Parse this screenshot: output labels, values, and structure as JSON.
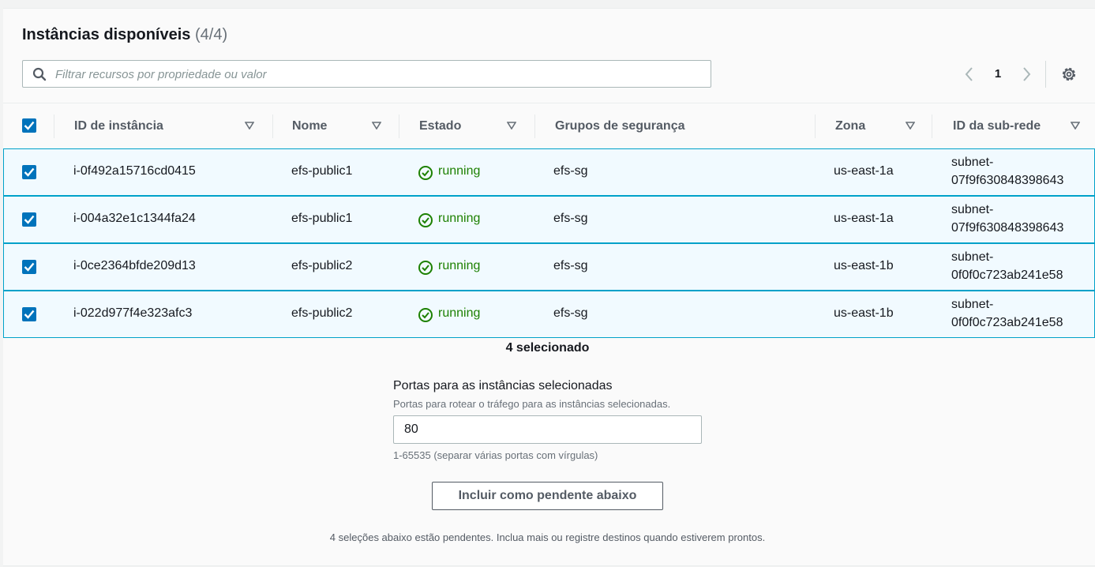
{
  "header": {
    "title": "Instâncias disponíveis",
    "count": "(4/4)"
  },
  "search": {
    "placeholder": "Filtrar recursos por propriedade ou valor"
  },
  "pagination": {
    "current_page": "1"
  },
  "table": {
    "columns": [
      "ID de instância",
      "Nome",
      "Estado",
      "Grupos de segurança",
      "Zona",
      "ID da sub-rede"
    ],
    "rows": [
      {
        "id": "i-0f492a15716cd0415",
        "name": "efs-public1",
        "state": "running",
        "sg": "efs-sg",
        "zone": "us-east-1a",
        "subnet_a": "subnet-",
        "subnet_b": "07f9f630848398643"
      },
      {
        "id": "i-004a32e1c1344fa24",
        "name": "efs-public1",
        "state": "running",
        "sg": "efs-sg",
        "zone": "us-east-1a",
        "subnet_a": "subnet-",
        "subnet_b": "07f9f630848398643"
      },
      {
        "id": "i-0ce2364bfde209d13",
        "name": "efs-public2",
        "state": "running",
        "sg": "efs-sg",
        "zone": "us-east-1b",
        "subnet_a": "subnet-",
        "subnet_b": "0f0f0c723ab241e58"
      },
      {
        "id": "i-022d977f4e323afc3",
        "name": "efs-public2",
        "state": "running",
        "sg": "efs-sg",
        "zone": "us-east-1b",
        "subnet_a": "subnet-",
        "subnet_b": "0f0f0c723ab241e58"
      }
    ]
  },
  "selection": {
    "count_label": "4 selecionado"
  },
  "ports": {
    "label": "Portas para as instâncias selecionadas",
    "description": "Portas para rotear o tráfego para as instâncias selecionadas.",
    "value": "80",
    "hint": "1-65535 (separar várias portas com vírgulas)"
  },
  "include_button": {
    "label": "Incluir como pendente abaixo"
  },
  "footer": {
    "note": "4 seleções abaixo estão pendentes. Inclua mais ou registre destinos quando estiverem prontos."
  },
  "colors": {
    "accent": "#0073bb",
    "running": "#1d8102",
    "row_selected_bg": "#f1faff",
    "row_selected_border": "#00a1c9"
  },
  "icons": {
    "search": "search-icon",
    "prev": "chevron-left-icon",
    "next": "chevron-right-icon",
    "settings": "gear-icon",
    "sort": "sort-caret-icon",
    "status": "check-circle-icon",
    "checkbox": "checkbox-checked-icon"
  }
}
